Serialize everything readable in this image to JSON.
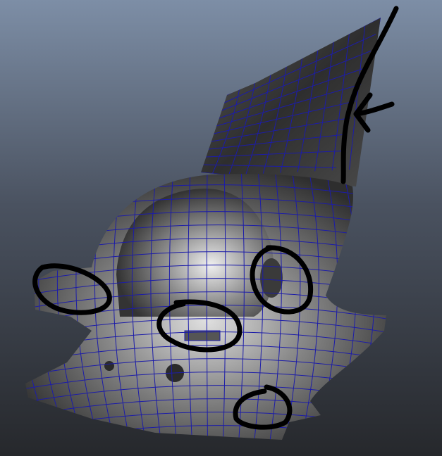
{
  "viewport": {
    "background_top": "#7d8ea6",
    "background_bottom": "#26282c",
    "mesh_light": "#d8d8d8",
    "mesh_dark": "#3a3a3a",
    "wireframe_color": "#1c1ca8",
    "annotation_color": "#000000"
  },
  "annotations": [
    {
      "type": "arrow",
      "target": "fin-edge"
    },
    {
      "type": "circle",
      "target": "left-brow"
    },
    {
      "type": "circle",
      "target": "front-slot"
    },
    {
      "type": "circle",
      "target": "right-eye-hole"
    },
    {
      "type": "circle",
      "target": "base-right"
    }
  ]
}
